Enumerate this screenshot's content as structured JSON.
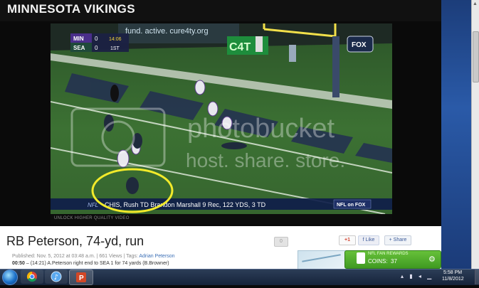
{
  "site": {
    "title": "MINNESOTA VIKINGS"
  },
  "video": {
    "scorebug": {
      "team1": "MIN",
      "score1": "0",
      "clock": "14:06",
      "team2": "SEA",
      "score2": "0",
      "down": "1ST"
    },
    "ad_text": "fund. active. cure4ty.org",
    "board_text": "C4T",
    "network_logo": "FOX",
    "watermark_brand": "photobucket",
    "watermark_tagline": "host. share. store.",
    "ticker_prefix": "NFL",
    "ticker_text": "CHIS, Rush TD   Brandon Marshall 9 Rec, 122 YDS, 3 TD",
    "ticker_logo": "NFL on FOX",
    "hq_link": "UNLOCK HIGHER QUALITY VIDEO"
  },
  "info": {
    "title": "RB Peterson, 74-yd, run",
    "meta": "Published: Nov. 5, 2012 at 03:48 a.m. | 661 Views | Tags:",
    "tag": "Adrian Peterson",
    "play_time": "00:50",
    "play_desc": " – (14:21) A.Peterson right end to SEA 1 for 74 yards (B.Browner)",
    "comments_count": "0",
    "gplus_label": "+1",
    "like_label": "Like",
    "share_label": "Share"
  },
  "rewards": {
    "title": "NFL FAN REWARDS",
    "coins_label": "COINS:",
    "coins_value": "37"
  },
  "taskbar": {
    "clock_time": "5:58 PM",
    "clock_date": "11/8/2012"
  },
  "colors": {
    "field": "#3a6a32",
    "rewards_green": "#4faa2a",
    "highlight_circle": "#f2ea2a"
  }
}
